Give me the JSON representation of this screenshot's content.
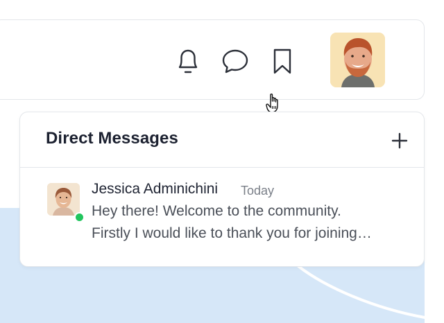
{
  "header": {
    "icons": {
      "notifications": "bell-icon",
      "messages": "chat-icon",
      "saved": "bookmark-icon"
    },
    "user_avatar": "user-avatar"
  },
  "direct_messages": {
    "title": "Direct Messages",
    "add_icon": "plus-icon",
    "items": [
      {
        "name": "Jessica Adminichini",
        "time": "Today",
        "preview_line1": "Hey there! Welcome to the community.",
        "preview_line2": "Firstly I would like to thank you for joining…",
        "status": "online"
      }
    ]
  },
  "colors": {
    "accent_blue": "#d6e7f8",
    "online_green": "#22c55e",
    "border": "#e3e6ea"
  }
}
